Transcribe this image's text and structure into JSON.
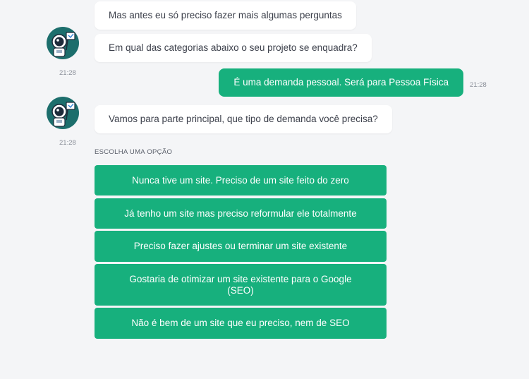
{
  "messages": {
    "bot1": "Mas antes eu só preciso fazer mais algumas perguntas",
    "bot2": "Em qual das categorias abaixo o seu projeto se enquadra?",
    "bot2_time": "21:28",
    "user1": "É uma demanda pessoal. Será para Pessoa Física",
    "user1_time": "21:28",
    "bot3": "Vamos para parte principal, que tipo de demanda você precisa?",
    "bot3_time": "21:28"
  },
  "choose_label": "ESCOLHA UMA OPÇÃO",
  "options": [
    {
      "label": "Nunca tive um site. Preciso de um site feito do zero"
    },
    {
      "label": "Já tenho um site mas preciso reformular ele totalmente"
    },
    {
      "label": "Preciso fazer ajustes ou terminar um site existente"
    },
    {
      "label": "Gostaria de otimizar um site existente para o Google (SEO)"
    },
    {
      "label": "Não é bem de um site que eu preciso, nem de SEO"
    }
  ],
  "colors": {
    "accent": "#17b07d",
    "avatar_bg": "#1c6e6c",
    "background": "#f4f5f7"
  },
  "icons": {
    "avatar": "astronaut-avatar-icon"
  }
}
